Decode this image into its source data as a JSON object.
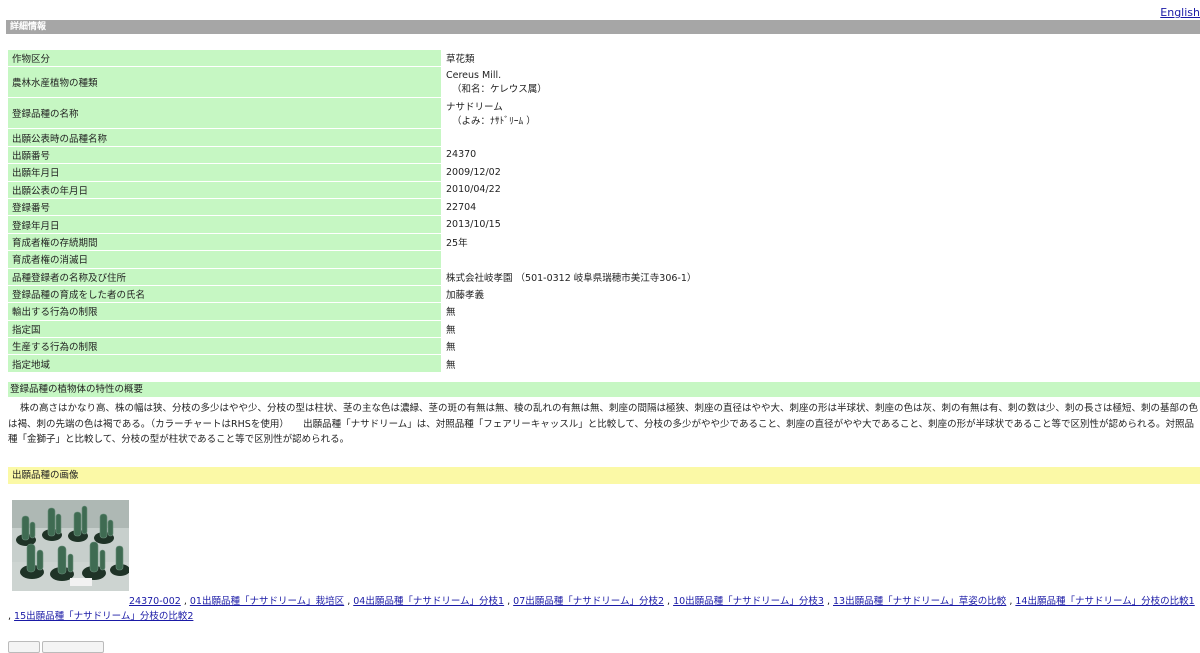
{
  "header": {
    "lang_link": "English",
    "section_title": "詳細情報"
  },
  "details": [
    {
      "label": "作物区分",
      "value": "草花類",
      "sub": ""
    },
    {
      "label": "農林水産植物の種類",
      "value": "Cereus Mill.",
      "sub": "（和名：ケレウス属）"
    },
    {
      "label": "登録品種の名称",
      "value": "ナサドリーム",
      "sub": "（よみ：ﾅｻﾄﾞﾘｰﾑ ）"
    },
    {
      "label": "出願公表時の品種名称",
      "value": "",
      "sub": ""
    },
    {
      "label": "出願番号",
      "value": "24370",
      "sub": ""
    },
    {
      "label": "出願年月日",
      "value": "2009/12/02",
      "sub": ""
    },
    {
      "label": "出願公表の年月日",
      "value": "2010/04/22",
      "sub": ""
    },
    {
      "label": "登録番号",
      "value": "22704",
      "sub": ""
    },
    {
      "label": "登録年月日",
      "value": "2013/10/15",
      "sub": ""
    },
    {
      "label": "育成者権の存続期間",
      "value": "25年",
      "sub": ""
    },
    {
      "label": "育成者権の消滅日",
      "value": "",
      "sub": ""
    },
    {
      "label": "品種登録者の名称及び住所",
      "value": "株式会社岐孝園 （501-0312 岐阜県瑞穂市美江寺306-1）",
      "sub": ""
    },
    {
      "label": "登録品種の育成をした者の氏名",
      "value": "加藤孝義",
      "sub": ""
    },
    {
      "label": "輸出する行為の制限",
      "value": "無",
      "sub": ""
    },
    {
      "label": "指定国",
      "value": "無",
      "sub": ""
    },
    {
      "label": "生産する行為の制限",
      "value": "無",
      "sub": ""
    },
    {
      "label": "指定地域",
      "value": "無",
      "sub": ""
    }
  ],
  "summary": {
    "heading": "登録品種の植物体の特性の概要",
    "text": "株の高さはかなり高、株の幅は狭、分枝の多少はやや少、分枝の型は柱状、茎の主な色は濃緑、茎の斑の有無は無、稜の乱れの有無は無、刺座の間隔は極狭、刺座の直径はやや大、刺座の形は半球状、刺座の色は灰、刺の有無は有、刺の数は少、刺の長さは極短、刺の基部の色は褐、刺の先端の色は褐である。（カラーチャートはRHSを使用）　　出願品種「ナサドリーム」は、対照品種「フェアリーキャッスル」と比較して、分枝の多少がやや少であること、刺座の直径がやや大であること、刺座の形が半球状であること等で区別性が認められる。対照品種「金獅子」と比較して、分枝の型が柱状であること等で区別性が認められる。"
  },
  "images": {
    "heading": "出願品種の画像",
    "links": [
      "24370-002",
      "01出願品種「ナサドリーム」栽培区",
      "04出願品種「ナサドリーム」分枝1",
      "07出願品種「ナサドリーム」分枝2",
      "10出願品種「ナサドリーム」分枝3",
      "13出願品種「ナサドリーム」草姿の比較",
      "14出願品種「ナサドリーム」分枝の比較1",
      "15出願品種「ナサドリーム」分枝の比較2"
    ]
  },
  "colors": {
    "label_bg": "#c6f7c3",
    "section_bar": "#a6a6a6",
    "image_head_bg": "#fbf9a6",
    "link": "#1a1aa6"
  }
}
